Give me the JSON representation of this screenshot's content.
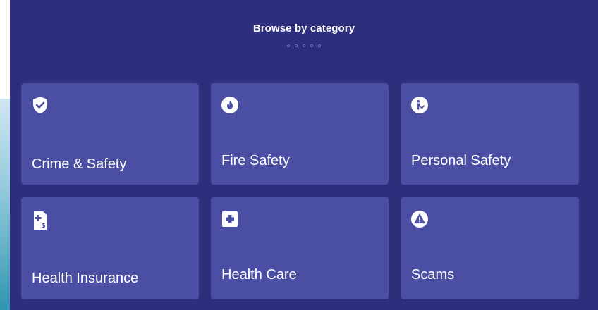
{
  "section": {
    "title": "Browse by category",
    "dot_count": 5
  },
  "categories": [
    {
      "label": "Crime & Safety",
      "icon": "shield-check-icon"
    },
    {
      "label": "Fire Safety",
      "icon": "flame-icon"
    },
    {
      "label": "Personal Safety",
      "icon": "person-check-icon"
    },
    {
      "label": "Health Insurance",
      "icon": "medical-document-dollar-icon"
    },
    {
      "label": "Health Care",
      "icon": "medical-cross-icon"
    },
    {
      "label": "Scams",
      "icon": "warning-triangle-icon"
    }
  ],
  "colors": {
    "panel_background": "#2d2e7c",
    "card_background": "#4a4fa3",
    "text": "#ffffff"
  }
}
